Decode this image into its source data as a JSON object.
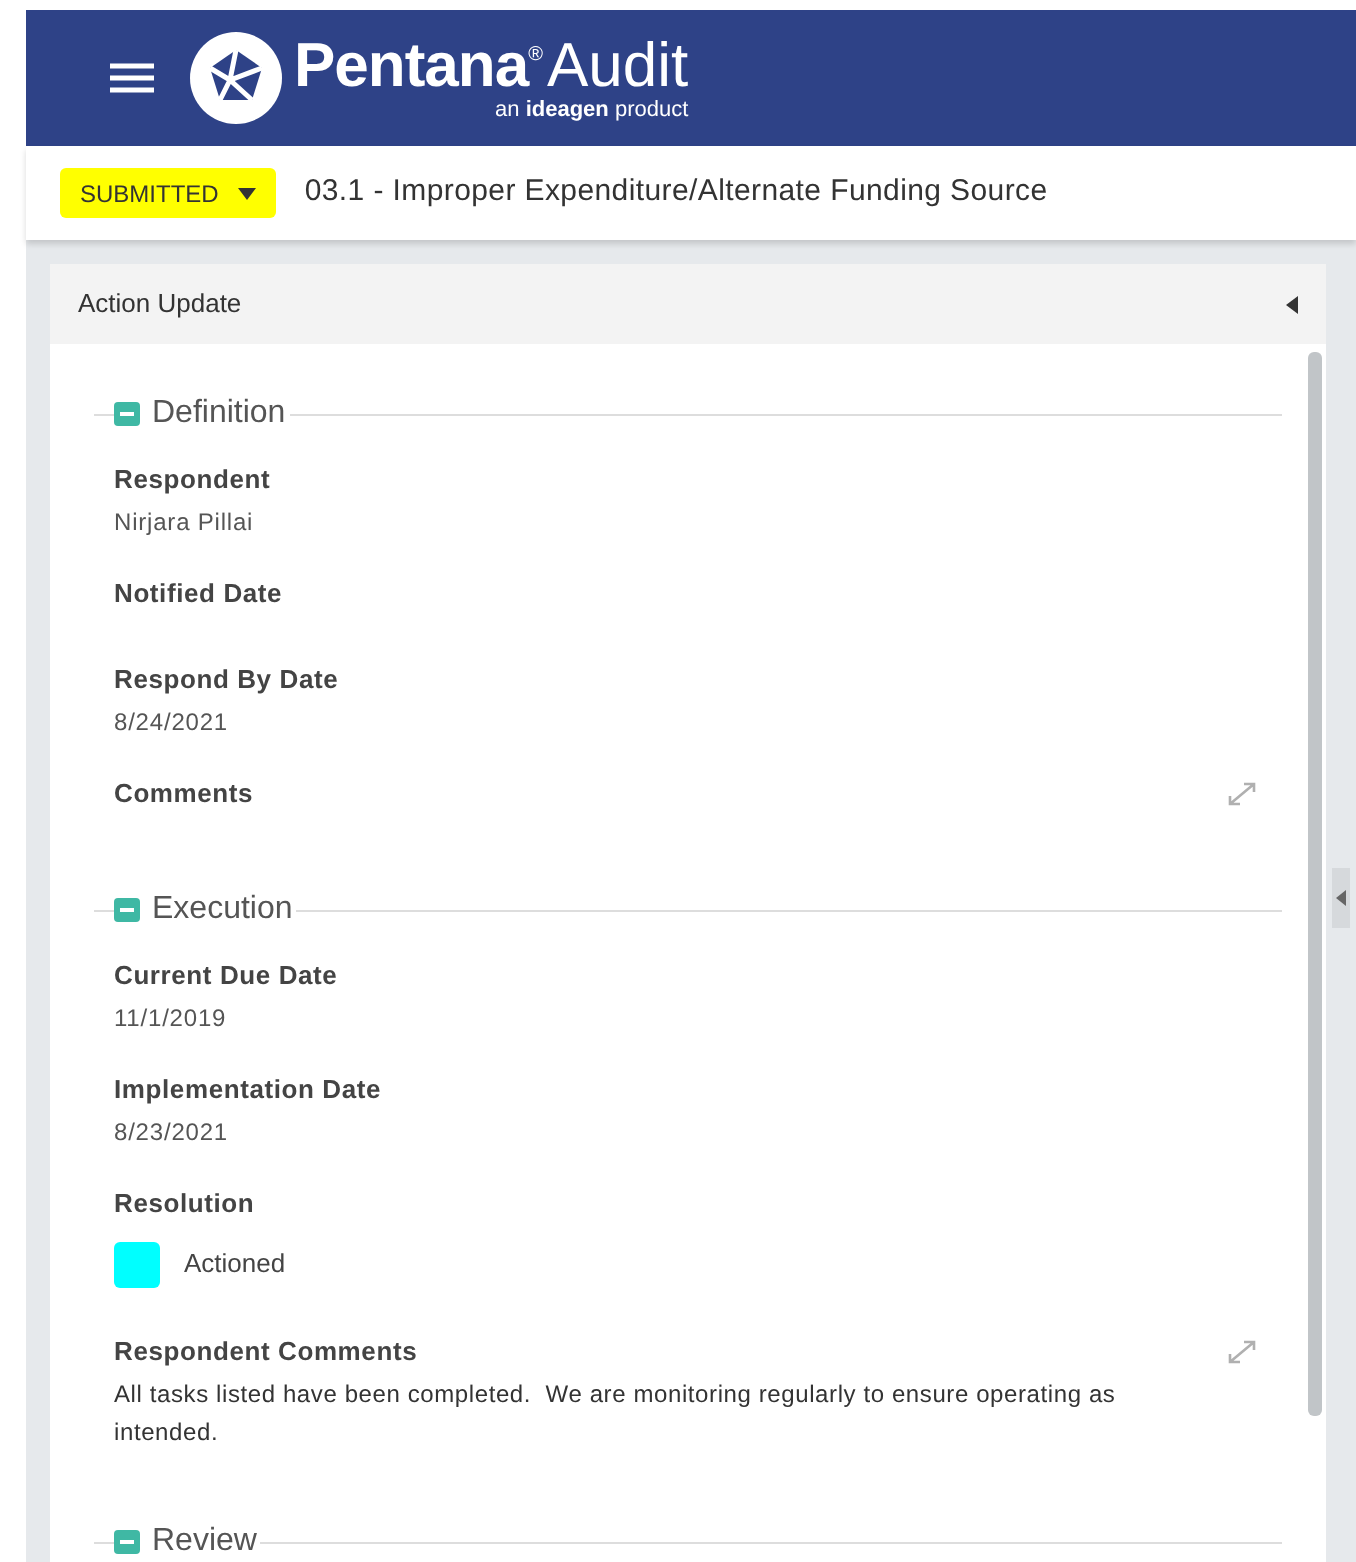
{
  "header": {
    "brand": "Pentana",
    "registered": "®",
    "product": "Audit",
    "tagline": "an **ideagen** product"
  },
  "status_bar": {
    "status": "SUBMITTED",
    "title": "03.1 - Improper Expenditure/Alternate Funding Source"
  },
  "panel": {
    "title": "Action Update",
    "sections": [
      {
        "title": "Definition",
        "expanded": true,
        "fields": [
          {
            "kind": "text",
            "label": "Respondent",
            "value": "Nirjara Pillai"
          },
          {
            "kind": "empty",
            "label": "Notified Date"
          },
          {
            "kind": "text",
            "label": "Respond By Date",
            "value": "8/24/2021"
          },
          {
            "kind": "expandable",
            "label": "Comments"
          }
        ]
      },
      {
        "title": "Execution",
        "expanded": true,
        "fields": [
          {
            "kind": "text",
            "label": "Current Due Date",
            "value": "11/1/2019"
          },
          {
            "kind": "text",
            "label": "Implementation Date",
            "value": "8/23/2021"
          },
          {
            "kind": "swatch",
            "label": "Resolution",
            "value": "Actioned",
            "color": "#00ffff"
          },
          {
            "kind": "expandable",
            "label": "Respondent Comments",
            "value": "All tasks listed have been completed.  We are monitoring regularly to ensure operating as intended."
          }
        ]
      },
      {
        "title": "Review",
        "expanded": true
      }
    ]
  }
}
